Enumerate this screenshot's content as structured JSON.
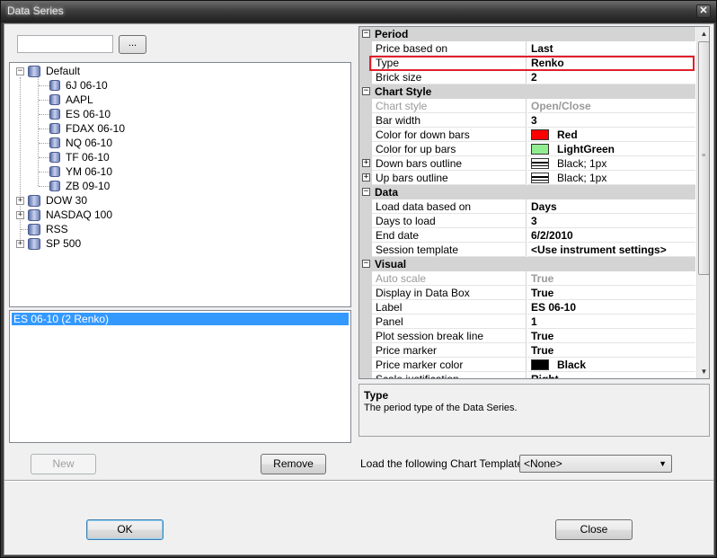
{
  "window": {
    "title": "Data Series",
    "close_glyph": "✕"
  },
  "left": {
    "search_value": "",
    "browse_label": "...",
    "tree": [
      {
        "label": "Default",
        "expanded": true,
        "glyph": "−"
      },
      {
        "label": "6J 06-10"
      },
      {
        "label": "AAPL"
      },
      {
        "label": "ES 06-10"
      },
      {
        "label": "FDAX 06-10"
      },
      {
        "label": "NQ 06-10"
      },
      {
        "label": "TF 06-10"
      },
      {
        "label": "YM 06-10"
      },
      {
        "label": "ZB 09-10"
      },
      {
        "label": "DOW 30",
        "expanded": false,
        "glyph": "+"
      },
      {
        "label": "NASDAQ 100",
        "expanded": false,
        "glyph": "+"
      },
      {
        "label": "RSS"
      },
      {
        "label": "SP 500",
        "expanded": false,
        "glyph": "+"
      }
    ],
    "series": [
      "ES 06-10 (2 Renko)"
    ],
    "new_label": "New",
    "remove_label": "Remove"
  },
  "grid": {
    "collapse_glyph": "−",
    "expand_glyph": "+",
    "categories": {
      "period": "Period",
      "chart_style": "Chart Style",
      "data": "Data",
      "visual": "Visual"
    },
    "rows": {
      "price_based_on": {
        "name": "Price based on",
        "value": "Last"
      },
      "type": {
        "name": "Type",
        "value": "Renko"
      },
      "brick_size": {
        "name": "Brick size",
        "value": "2"
      },
      "chart_style": {
        "name": "Chart style",
        "value": "Open/Close"
      },
      "bar_width": {
        "name": "Bar width",
        "value": "3"
      },
      "color_down": {
        "name": "Color for down bars",
        "value": "Red",
        "color": "#ff0000"
      },
      "color_up": {
        "name": "Color for up bars",
        "value": "LightGreen",
        "color": "#90ee90"
      },
      "down_outline": {
        "name": "Down bars outline",
        "value": "Black; 1px"
      },
      "up_outline": {
        "name": "Up bars outline",
        "value": "Black; 1px"
      },
      "load_based_on": {
        "name": "Load data based on",
        "value": "Days"
      },
      "days_to_load": {
        "name": "Days to load",
        "value": "3"
      },
      "end_date": {
        "name": "End date",
        "value": "6/2/2010"
      },
      "session_template": {
        "name": "Session template",
        "value": "<Use instrument settings>"
      },
      "auto_scale": {
        "name": "Auto scale",
        "value": "True"
      },
      "display_in_data_box": {
        "name": "Display in Data Box",
        "value": "True"
      },
      "label": {
        "name": "Label",
        "value": "ES 06-10"
      },
      "panel": {
        "name": "Panel",
        "value": "1"
      },
      "plot_session_break": {
        "name": "Plot session break line",
        "value": "True"
      },
      "price_marker": {
        "name": "Price marker",
        "value": "True"
      },
      "price_marker_color": {
        "name": "Price marker color",
        "value": "Black",
        "color": "#000000"
      },
      "scale_justification": {
        "name": "Scale justification",
        "value": "Right"
      }
    },
    "scroll_up": "▲",
    "scroll_down": "▼",
    "grip": "≡",
    "highlight_color": "#e0202a"
  },
  "description": {
    "title": "Type",
    "text": "The period type of the Data Series."
  },
  "template": {
    "label": "Load the following Chart Template:",
    "value": "<None>",
    "arrow": "▼"
  },
  "footer": {
    "ok_label": "OK",
    "close_label": "Close"
  }
}
